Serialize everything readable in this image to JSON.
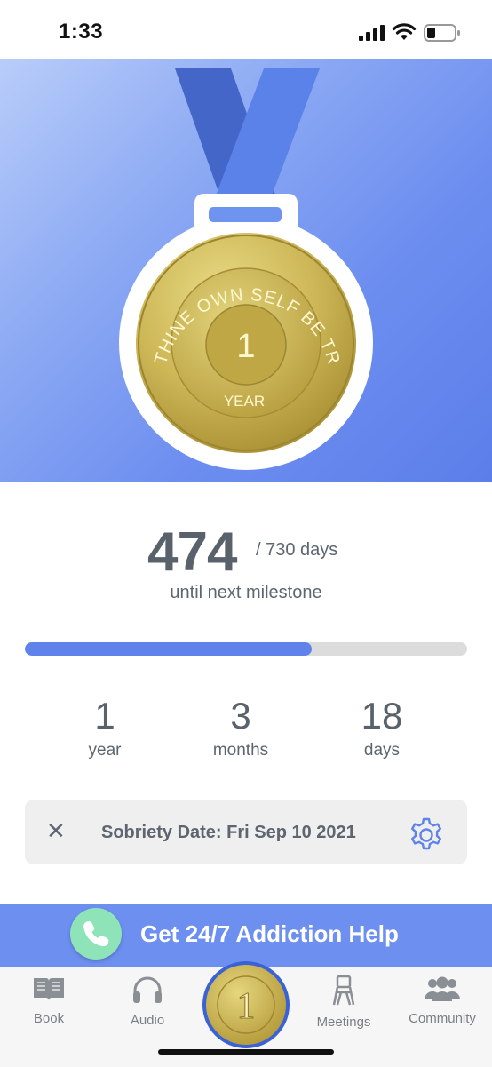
{
  "status_bar": {
    "time": "1:33"
  },
  "medal": {
    "motto": "TO THINE OWN SELF BE TRUE",
    "number": "1",
    "unit": "YEAR"
  },
  "progress": {
    "days_count": "474",
    "days_total": "/ 730 days",
    "caption": "until next milestone",
    "fraction": 0.649
  },
  "stats": [
    {
      "value": "1",
      "unit": "year"
    },
    {
      "value": "3",
      "unit": "months"
    },
    {
      "value": "18",
      "unit": "days"
    }
  ],
  "sobriety": {
    "label": "Sobriety Date: Fri Sep 10 2021"
  },
  "help_banner": {
    "label": "Get 24/7 Addiction Help"
  },
  "tabs": [
    {
      "label": "Book",
      "icon": "book-icon"
    },
    {
      "label": "Audio",
      "icon": "headphones-icon"
    },
    {
      "label": "",
      "icon": "coin-icon",
      "center_number": "1"
    },
    {
      "label": "Meetings",
      "icon": "chair-icon"
    },
    {
      "label": "Community",
      "icon": "people-icon"
    }
  ],
  "colors": {
    "accent": "#5f83ea",
    "help_banner": "#6d8ff0",
    "phone_green": "#8ee3b8",
    "gold": "#d4c063"
  }
}
